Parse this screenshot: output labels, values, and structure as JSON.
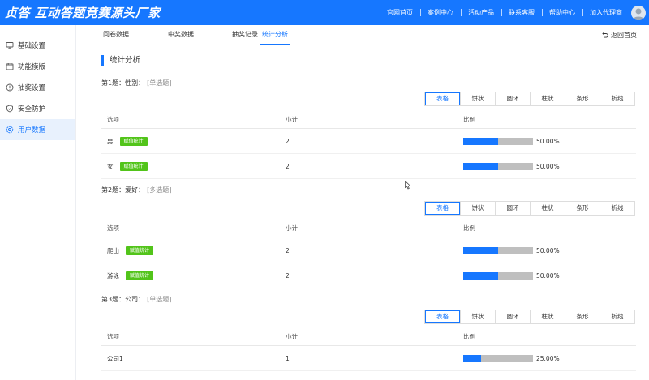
{
  "header": {
    "brand": "贞答 互动答题竞赛源头厂家",
    "nav": [
      "官网首页",
      "案例中心",
      "活动产品",
      "联系客服",
      "帮助中心",
      "加入代理商"
    ]
  },
  "sidebar": {
    "items": [
      {
        "label": "基础设置",
        "icon": "monitor-icon",
        "active": false
      },
      {
        "label": "功能模版",
        "icon": "calendar-icon",
        "active": false
      },
      {
        "label": "抽奖设置",
        "icon": "info-circle-icon",
        "active": false
      },
      {
        "label": "安全防护",
        "icon": "shield-icon",
        "active": false
      },
      {
        "label": "用户数据",
        "icon": "settings-icon",
        "active": true
      }
    ]
  },
  "tabs": [
    {
      "label": "问卷数据",
      "active": false
    },
    {
      "label": "中奖数据",
      "active": false
    },
    {
      "label": "抽奖记录",
      "active": false
    },
    {
      "label": "统计分析",
      "active": true
    }
  ],
  "back_home": "返回首页",
  "section_title": "统计分析",
  "chart_buttons": [
    "表格",
    "饼状",
    "圆环",
    "柱状",
    "条形",
    "折线"
  ],
  "table_headers": {
    "option": "选项",
    "subtotal": "小计",
    "ratio": "比例"
  },
  "tag_label": "赋值统计",
  "questions": [
    {
      "title": "第1题：性别：",
      "type": "[单选题]",
      "rows": [
        {
          "option": "男",
          "tag": true,
          "count": "2",
          "fraction": 0.5,
          "percent": "50.00%"
        },
        {
          "option": "女",
          "tag": true,
          "count": "2",
          "fraction": 0.5,
          "percent": "50.00%"
        }
      ]
    },
    {
      "title": "第2题：爱好：",
      "type": "[多选题]",
      "rows": [
        {
          "option": "爬山",
          "tag": true,
          "count": "2",
          "fraction": 0.5,
          "percent": "50.00%"
        },
        {
          "option": "游泳",
          "tag": true,
          "count": "2",
          "fraction": 0.5,
          "percent": "50.00%"
        }
      ]
    },
    {
      "title": "第3题：公司：",
      "type": "[单选题]",
      "rows": [
        {
          "option": "公司1",
          "tag": false,
          "count": "1",
          "fraction": 0.25,
          "percent": "25.00%"
        }
      ]
    }
  ],
  "colors": {
    "primary": "#1677ff",
    "tag": "#52c41a",
    "bar_track": "#bfbfbf"
  }
}
